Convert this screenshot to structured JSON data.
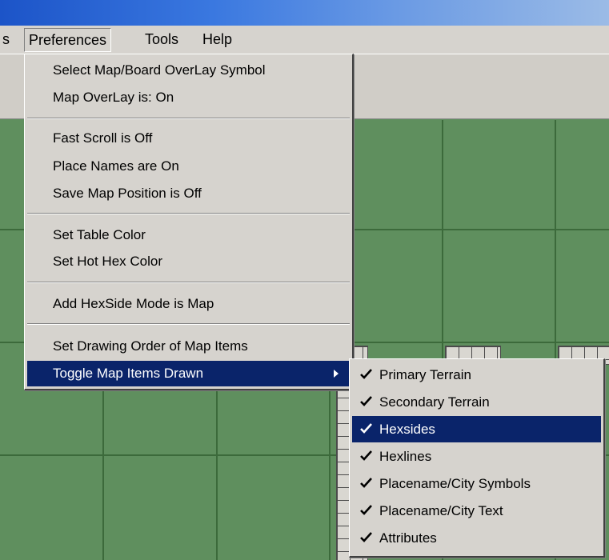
{
  "menubar": {
    "items": [
      {
        "label": "s",
        "name": "menubar-item-partial"
      },
      {
        "label": "Preferences",
        "name": "menubar-item-preferences",
        "open": true
      },
      {
        "label": "Tools",
        "name": "menubar-item-tools"
      },
      {
        "label": "Help",
        "name": "menubar-item-help"
      }
    ]
  },
  "preferences_menu": {
    "items": [
      {
        "label": "Select Map/Board OverLay Symbol"
      },
      {
        "label": "Map OverLay is: On"
      },
      {
        "label": "Fast Scroll is Off"
      },
      {
        "label": "Place Names are On"
      },
      {
        "label": "Save Map Position is Off"
      },
      {
        "label": "Set Table Color"
      },
      {
        "label": "Set Hot Hex Color"
      },
      {
        "label": "Add HexSide Mode is Map"
      },
      {
        "label": "Set Drawing Order of Map Items"
      },
      {
        "label": "Toggle Map Items Drawn",
        "highlighted": true,
        "has_submenu": true
      }
    ]
  },
  "toggle_submenu": {
    "items": [
      {
        "label": "Primary Terrain",
        "checked": true
      },
      {
        "label": "Secondary Terrain",
        "checked": true
      },
      {
        "label": "Hexsides",
        "checked": true,
        "highlighted": true
      },
      {
        "label": "Hexlines",
        "checked": true
      },
      {
        "label": "Placename/City Symbols",
        "checked": true
      },
      {
        "label": "Placename/City Text",
        "checked": true
      },
      {
        "label": "Attributes",
        "checked": true
      }
    ]
  },
  "colors": {
    "map_green": "#5f8f5e",
    "menu_face": "#d6d3ce",
    "highlight": "#0a246a",
    "titlebar_blue": "#1c54c8"
  }
}
